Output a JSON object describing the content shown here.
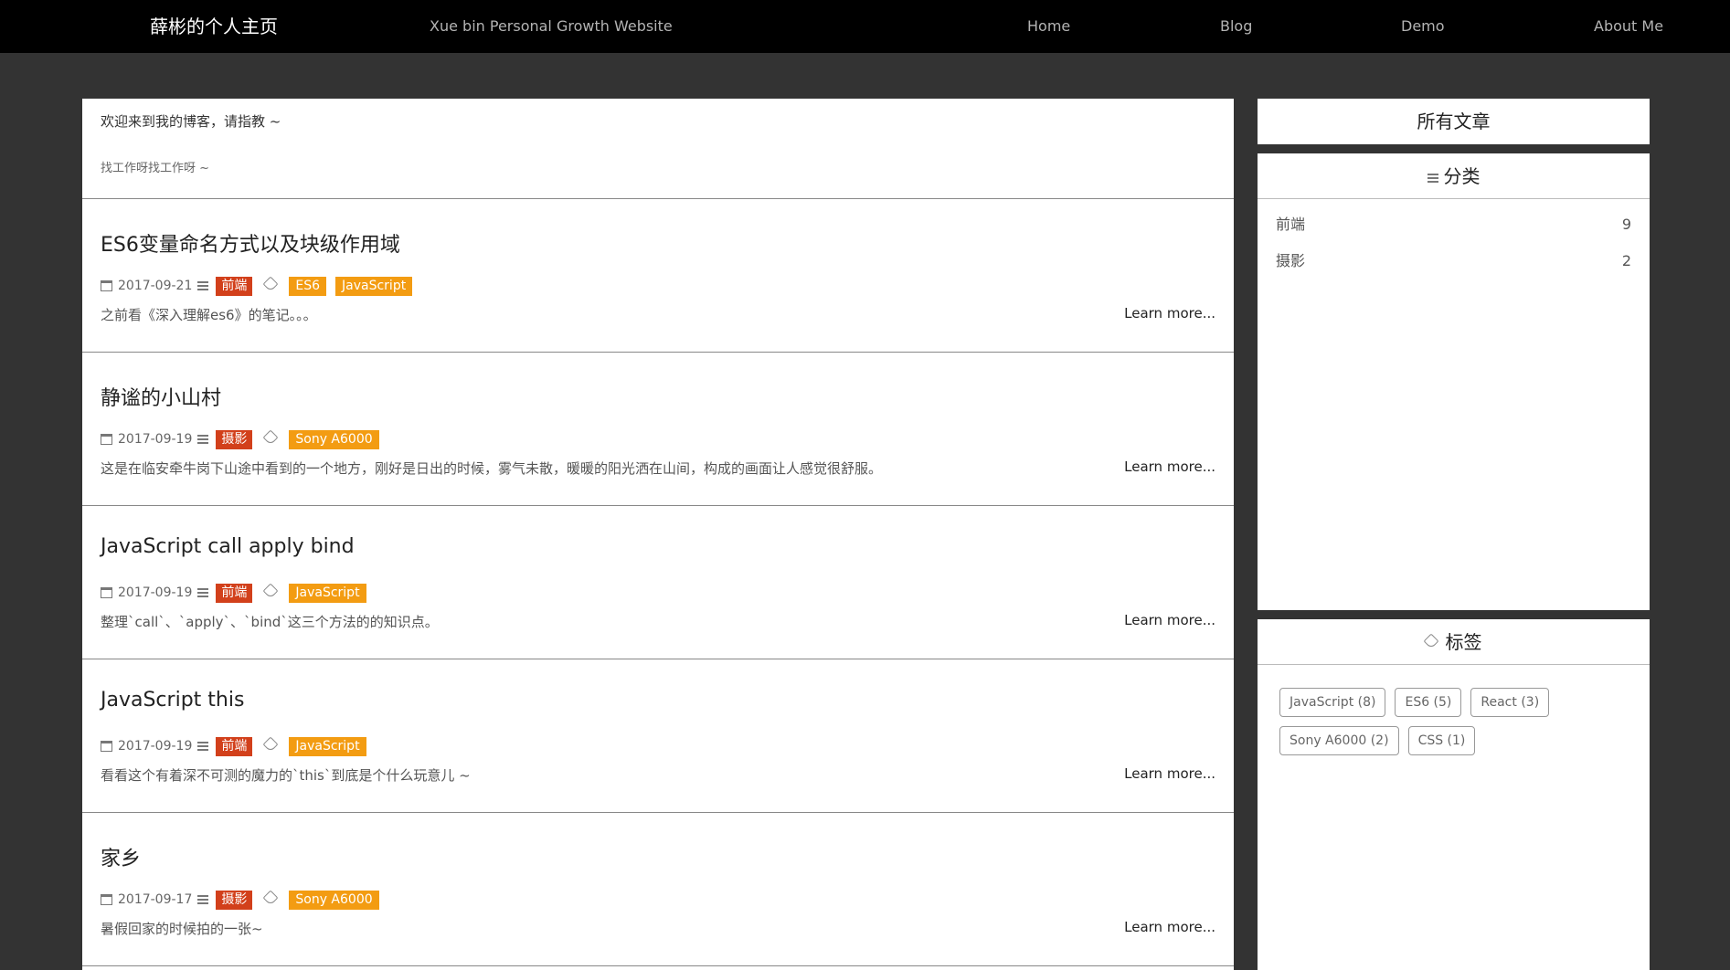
{
  "header": {
    "brand": "薛彬的个人主页",
    "subtitle": "Xue bin Personal Growth Website",
    "nav": [
      "Home",
      "Blog",
      "Demo",
      "About Me"
    ]
  },
  "welcome": {
    "line1": "欢迎来到我的博客，请指教 ~",
    "line2": "找工作呀找工作呀 ~"
  },
  "posts": [
    {
      "title": "ES6变量命名方式以及块级作用域",
      "date": "2017-09-21",
      "category": "前端",
      "tags": [
        "ES6",
        "JavaScript"
      ],
      "excerpt": "之前看《深入理解es6》的笔记。。。",
      "more": "Learn more..."
    },
    {
      "title": "静谧的小山村",
      "date": "2017-09-19",
      "category": "摄影",
      "tags": [
        "Sony A6000"
      ],
      "excerpt": "这是在临安牵牛岗下山途中看到的一个地方，刚好是日出的时候，雾气未散，暖暖的阳光洒在山间，构成的画面让人感觉很舒服。",
      "more": "Learn more..."
    },
    {
      "title": "JavaScript call apply bind",
      "date": "2017-09-19",
      "category": "前端",
      "tags": [
        "JavaScript"
      ],
      "excerpt": "整理`call`、`apply`、`bind`这三个方法的的知识点。",
      "more": "Learn more..."
    },
    {
      "title": "JavaScript this",
      "date": "2017-09-19",
      "category": "前端",
      "tags": [
        "JavaScript"
      ],
      "excerpt": "看看这个有着深不可测的魔力的`this`到底是个什么玩意儿 ~",
      "more": "Learn more..."
    },
    {
      "title": "家乡",
      "date": "2017-09-17",
      "category": "摄影",
      "tags": [
        "Sony A6000"
      ],
      "excerpt": "暑假回家的时候拍的一张~",
      "more": "Learn more..."
    }
  ],
  "sidebar": {
    "all_posts": "所有文章",
    "categories_title": "分类",
    "categories": [
      {
        "name": "前端",
        "count": "9"
      },
      {
        "name": "摄影",
        "count": "2"
      }
    ],
    "tags_title": "标签",
    "tags": [
      "JavaScript (8)",
      "ES6 (5)",
      "React (3)",
      "Sony A6000 (2)",
      "CSS (1)"
    ]
  },
  "colors": {
    "category_badge": "#d2401b",
    "tag_badge": "#f39c12",
    "page_background": "#333333",
    "nav_background": "#000000"
  }
}
